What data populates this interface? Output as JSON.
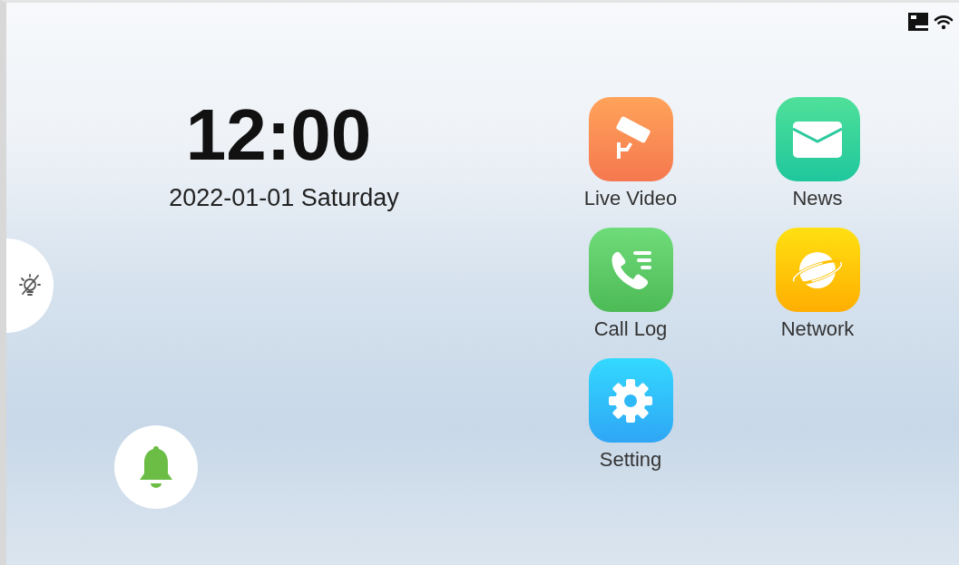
{
  "clock": {
    "time": "12:00",
    "date": "2022-01-01 Saturday"
  },
  "apps": [
    {
      "kind": "camera",
      "label": "Live Video"
    },
    {
      "kind": "mail",
      "label": "News"
    },
    {
      "kind": "phone",
      "label": "Call Log"
    },
    {
      "kind": "planet",
      "label": "Network"
    },
    {
      "kind": "gear",
      "label": "Setting"
    }
  ]
}
